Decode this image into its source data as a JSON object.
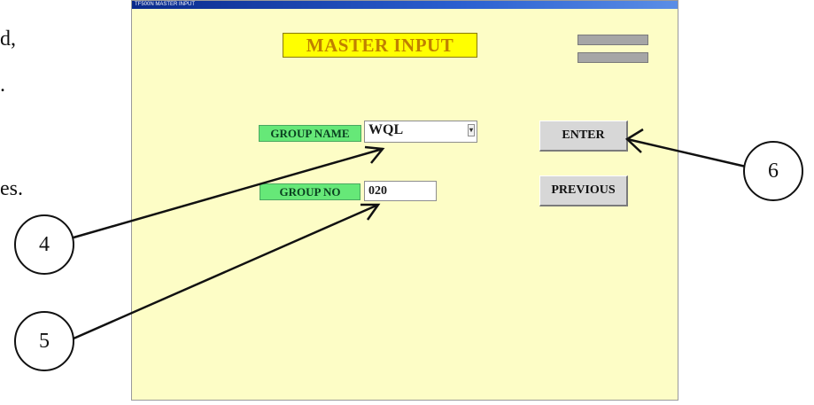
{
  "side_text": [
    "d,",
    ".",
    "es."
  ],
  "window": {
    "title": "TF500N MASTER INPUT",
    "heading": "MASTER INPUT",
    "mini_buttons": [
      "",
      ""
    ],
    "group_name": {
      "label": "GROUP NAME",
      "value": "WQL"
    },
    "group_no": {
      "label": "GROUP NO",
      "value": "020"
    },
    "buttons": {
      "enter": "ENTER",
      "previous": "PREVIOUS"
    }
  },
  "callouts": {
    "c4": "4",
    "c5": "5",
    "c6": "6"
  }
}
